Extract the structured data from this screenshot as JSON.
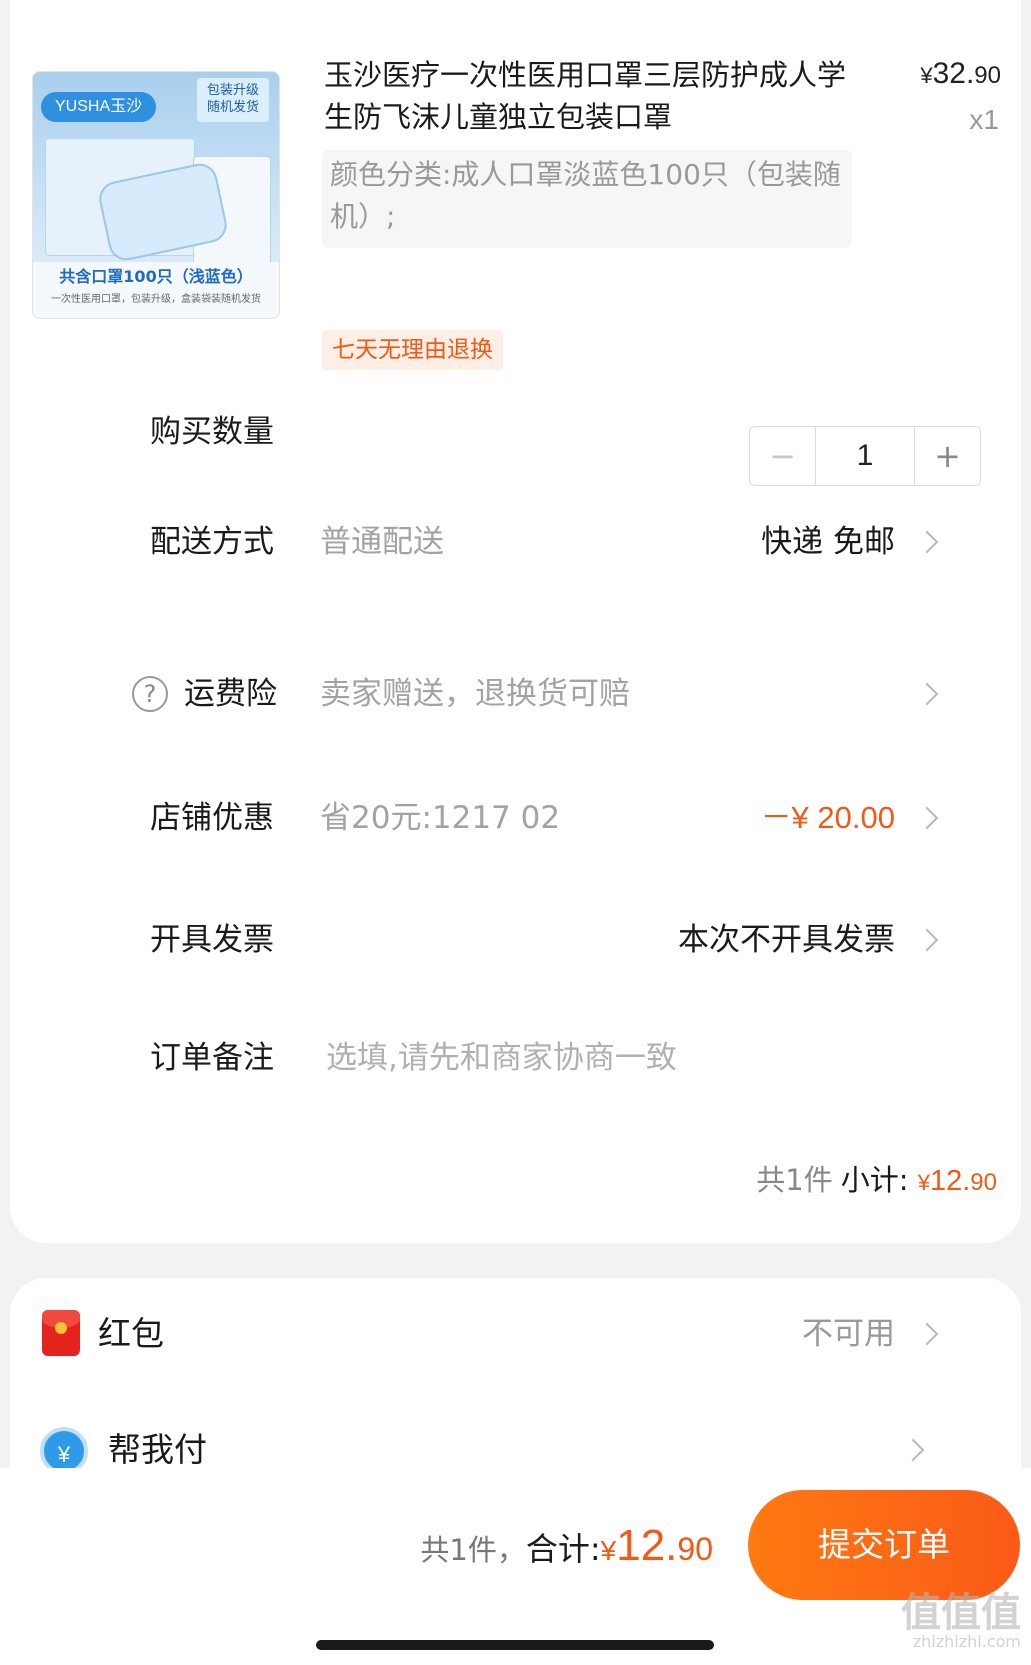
{
  "product": {
    "image_alt": "玉沙一次性医用口罩包装",
    "brand_badge": "YUSHA玉沙",
    "corner_text": "包装升级\n随机发货",
    "image_caption": "共含口罩100只（浅蓝色）",
    "image_subcaption": "一次性医用口罩，包装升级，盒装袋装随机发货",
    "title": "玉沙医疗一次性医用口罩三层防护成人学生防飞沫儿童独立包装口罩",
    "price_symbol": "¥",
    "price_int": "32.",
    "price_dec": "90",
    "quantity_label": "x1",
    "sku": "颜色分类:成人口罩淡蓝色100只（包装随机）;",
    "tag": "七天无理由退换"
  },
  "quantity": {
    "label": "购买数量",
    "minus": "−",
    "value": "1",
    "plus": "+"
  },
  "delivery": {
    "label": "配送方式",
    "sub": "普通配送",
    "value": "快递 免邮"
  },
  "insurance": {
    "icon": "?",
    "label": "运费险",
    "sub": "卖家赠送，退换货可赔"
  },
  "store_discount": {
    "label": "店铺优惠",
    "sub": "省20元:1217 02",
    "value": "－¥ 20.00"
  },
  "invoice": {
    "label": "开具发票",
    "value": "本次不开具发票"
  },
  "note": {
    "label": "订单备注",
    "placeholder": "选填,请先和商家协商一致"
  },
  "subtotal": {
    "count": "共1件",
    "label": "小计:",
    "symbol": "¥",
    "int": "12.",
    "dec": "90"
  },
  "red_packet": {
    "label": "红包",
    "value": "不可用"
  },
  "help_pay": {
    "icon": "¥",
    "label": "帮我付"
  },
  "footer": {
    "count": "共1件，",
    "label": "合计:",
    "symbol": "¥",
    "int": "12.",
    "dec": "90",
    "submit": "提交订单"
  },
  "watermark": {
    "main": "值值值",
    "small": "zhizhizhi.com"
  },
  "colors": {
    "accent": "#f05a14",
    "submit_start": "#fe7a12",
    "submit_end": "#fb5a17",
    "background": "#f2f2f2"
  }
}
